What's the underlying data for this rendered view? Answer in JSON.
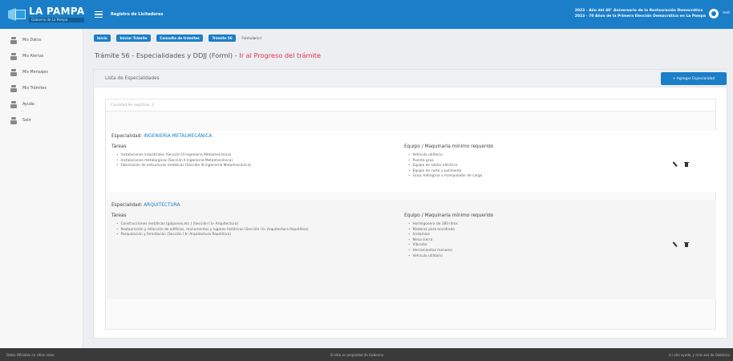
{
  "header": {
    "logo_text": "LA PAMPA",
    "logo_subtext": "Gobierno de La Pampa",
    "app_title": "Registro de Licitadores",
    "notice_line1": "2023 - Año del 40° Aniversario de la Restauración Democrática",
    "notice_line2": "2023 - 70 Años de la Primera Elección Democrática en La Pampa",
    "user_name": "test"
  },
  "sidebar": {
    "items": [
      {
        "label": "Mis Datos"
      },
      {
        "label": "Mis Alertas"
      },
      {
        "label": "Mis Mensajes"
      },
      {
        "label": "Mis Trámites"
      },
      {
        "label": "Ayuda"
      },
      {
        "label": "Salir"
      }
    ]
  },
  "breadcrumb": {
    "items": [
      "Inicio",
      "Iniciar Trámite",
      "Consulta de trámites",
      "Trámite 56"
    ],
    "current": "Formulario I"
  },
  "page": {
    "title": "Trámite 56 - Especialidades y DDJJ (FormI) - ",
    "progress_link": "Ir al Progreso del trámite"
  },
  "card": {
    "header": "Lista de Especialidades",
    "add_button": "+ Agregar Especialidad",
    "record_count": "Cantidad de registros: 2"
  },
  "specialties": [
    {
      "label": "Especialidad:",
      "name": "INGENIERÍA METALMECÁNICA",
      "tasks_title": "Tareas",
      "tasks": [
        "Instalaciones industriales (Sección III Ingeniería Metalmecánica)",
        "Instalaciones metalúrgicas (Sección II Ingeniería Metalmecánica)",
        "Fabricación de estructuras metálicas (Sección III Ingeniería Metalmecánica)"
      ],
      "equipment_title": "Equipo / Maquinaria mínimo requerido",
      "equipment": [
        "Vehículo utilitario",
        "Puente grúa",
        "Equipo de soldar eléctrico",
        "Equipo de corte y pulimento",
        "Grúa, hidrogrúa o manipulador de carga"
      ]
    },
    {
      "label": "Especialidad:",
      "name": "ARQUITECTURA",
      "tasks_title": "Tareas",
      "tasks": [
        "Construcciones metálicas (galpones,etc.) (Sección I b- Arquitectura)",
        "Restauración y refacción de edificios, monumentos y lugares históricos (Sección I b- Arquitectura Repetitiva)",
        "Parquización y forestación (Sección I b- Arquitectura Repetitiva)"
      ],
      "equipment_title": "Equipo / Maquinaria mínimo requerido",
      "equipment": [
        "Hormigonera de 180 litros",
        "Maderas para encofrado",
        "Andamios",
        "Mesa sierra",
        "Vibrador",
        "Herramientas menores",
        "Vehículo utilitario"
      ]
    }
  ],
  "footer": {
    "left": "Datos Oficiales en sitios rutas",
    "middle": "El sitio es propiedad de Gobierno",
    "right": "(c) año ayuda, y más acá de Gobierno"
  }
}
